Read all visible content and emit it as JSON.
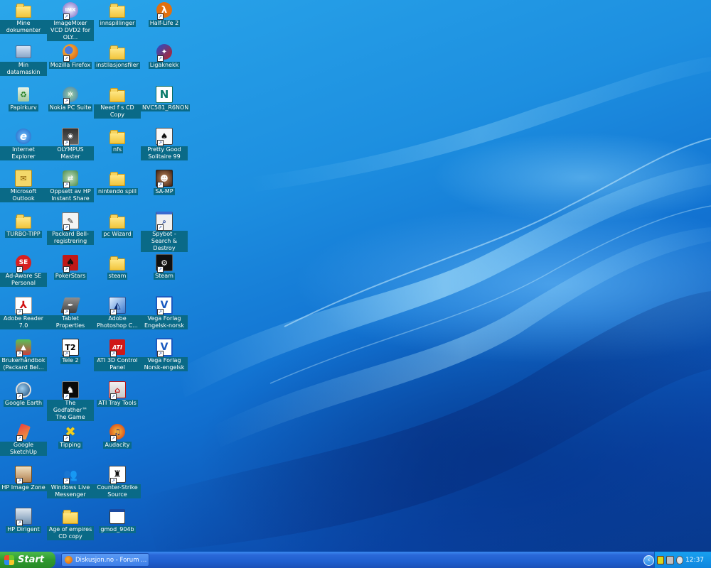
{
  "desktop_icons": [
    {
      "label": "Mine dokumenter",
      "icon": "my-documents-icon",
      "shortcut": false
    },
    {
      "label": "Min datamaskin",
      "icon": "my-computer-icon",
      "shortcut": false
    },
    {
      "label": "Papirkurv",
      "icon": "recycle-bin-icon",
      "shortcut": false
    },
    {
      "label": "Internet Explorer",
      "icon": "internet-explorer-icon",
      "shortcut": false
    },
    {
      "label": "Microsoft Outlook",
      "icon": "outlook-icon",
      "shortcut": false
    },
    {
      "label": "TURBO-TIPP",
      "icon": "folder-icon",
      "shortcut": false
    },
    {
      "label": "Ad-Aware SE Personal",
      "icon": "ad-aware-icon",
      "shortcut": true
    },
    {
      "label": "Adobe Reader 7.0",
      "icon": "adobe-reader-icon",
      "shortcut": true
    },
    {
      "label": "Brukerhåndbok (Packard Bel...",
      "icon": "manual-icon",
      "shortcut": true
    },
    {
      "label": "Google Earth",
      "icon": "google-earth-icon",
      "shortcut": true
    },
    {
      "label": "Google SketchUp",
      "icon": "sketchup-icon",
      "shortcut": true
    },
    {
      "label": "HP Image Zone",
      "icon": "hp-image-zone-icon",
      "shortcut": true
    },
    {
      "label": "HP Dirigent",
      "icon": "hp-dirigent-icon",
      "shortcut": true
    },
    {
      "label": "ImageMixer VCD DVD2 for OLY...",
      "icon": "imagemixer-icon",
      "shortcut": true
    },
    {
      "label": "Mozilla Firefox",
      "icon": "firefox-icon",
      "shortcut": true
    },
    {
      "label": "Nokia PC Suite",
      "icon": "nokia-pc-suite-icon",
      "shortcut": true
    },
    {
      "label": "OLYMPUS Master",
      "icon": "olympus-icon",
      "shortcut": true
    },
    {
      "label": "Oppsett av HP Instant Share",
      "icon": "hp-instant-share-icon",
      "shortcut": true
    },
    {
      "label": "Packard Bell-registrering",
      "icon": "registration-icon",
      "shortcut": true
    },
    {
      "label": "PokerStars",
      "icon": "pokerstars-icon",
      "shortcut": true
    },
    {
      "label": "Tablet Properties",
      "icon": "tablet-icon",
      "shortcut": true
    },
    {
      "label": "Tele 2",
      "icon": "tele2-icon",
      "shortcut": true
    },
    {
      "label": "The Godfather™ The Game",
      "icon": "godfather-icon",
      "shortcut": true
    },
    {
      "label": "Tipping",
      "icon": "tipping-icon",
      "shortcut": true
    },
    {
      "label": "Windows Live Messenger",
      "icon": "messenger-icon",
      "shortcut": true
    },
    {
      "label": "Age of empires CD copy",
      "icon": "folder-icon",
      "shortcut": false
    },
    {
      "label": "innspillinger",
      "icon": "folder-icon",
      "shortcut": false
    },
    {
      "label": "instllasjonsfiler",
      "icon": "folder-icon",
      "shortcut": false
    },
    {
      "label": "Need f s CD Copy",
      "icon": "folder-icon",
      "shortcut": false
    },
    {
      "label": "nfs",
      "icon": "folder-icon",
      "shortcut": false
    },
    {
      "label": "nintendo spill",
      "icon": "folder-icon",
      "shortcut": false
    },
    {
      "label": "pc Wizard",
      "icon": "folder-icon",
      "shortcut": false
    },
    {
      "label": "steam",
      "icon": "folder-icon",
      "shortcut": false
    },
    {
      "label": "Adobe Photoshop C...",
      "icon": "photoshop-icon",
      "shortcut": true
    },
    {
      "label": "ATI 3D Control Panel",
      "icon": "ati-icon",
      "shortcut": true
    },
    {
      "label": "ATI Tray Tools",
      "icon": "ati-tray-icon",
      "shortcut": true
    },
    {
      "label": "Audacity",
      "icon": "audacity-icon",
      "shortcut": true
    },
    {
      "label": "Counter-Strike Source",
      "icon": "counter-strike-icon",
      "shortcut": true
    },
    {
      "label": "gmod_904b",
      "icon": "window-app-icon",
      "shortcut": false
    },
    {
      "label": "Half-Life 2",
      "icon": "half-life-icon",
      "shortcut": true
    },
    {
      "label": "Ligaknekk",
      "icon": "ligaknekk-icon",
      "shortcut": true
    },
    {
      "label": "NVC581_R6NON",
      "icon": "nvc-icon",
      "shortcut": false
    },
    {
      "label": "Pretty Good Solitaire 99",
      "icon": "solitaire-icon",
      "shortcut": true
    },
    {
      "label": "SA-MP",
      "icon": "samp-icon",
      "shortcut": true
    },
    {
      "label": "Spybot - Search & Destroy",
      "icon": "spybot-icon",
      "shortcut": true
    },
    {
      "label": "Steam",
      "icon": "steam-icon",
      "shortcut": true
    },
    {
      "label": "Vega Forlag Engelsk-norsk",
      "icon": "vega-icon",
      "shortcut": true
    },
    {
      "label": "Vega Forlag Norsk-engelsk",
      "icon": "vega-icon",
      "shortcut": true
    }
  ],
  "taskbar": {
    "start_label": "Start",
    "tasks": [
      {
        "label": "Diskusjon.no - Forum ...",
        "icon": "firefox-icon"
      }
    ],
    "tray_toggle": "‹",
    "clock": "12:37"
  },
  "colors": {
    "label_bg": "#0a6a87",
    "taskbar": "#1f5fcf",
    "start_green": "#2f9a2f",
    "tray": "#0f86de"
  }
}
